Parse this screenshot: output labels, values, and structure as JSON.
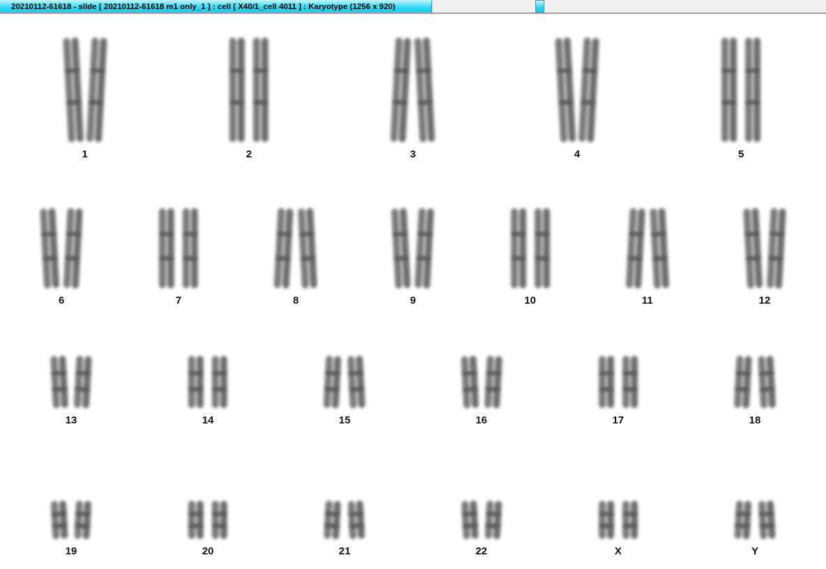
{
  "window": {
    "title": "20210112-61618 - slide [ 20210112-61618 m1 only_1 ] : cell [ X40/1_cell 4011 ] : Karyotype  (1256 x 920)"
  },
  "karyotype": {
    "rows": [
      {
        "items": [
          {
            "label": "1"
          },
          {
            "label": "2"
          },
          {
            "label": "3"
          },
          {
            "label": "4"
          },
          {
            "label": "5"
          }
        ]
      },
      {
        "items": [
          {
            "label": "6"
          },
          {
            "label": "7"
          },
          {
            "label": "8"
          },
          {
            "label": "9"
          },
          {
            "label": "10"
          },
          {
            "label": "11"
          },
          {
            "label": "12"
          }
        ]
      },
      {
        "items": [
          {
            "label": "13"
          },
          {
            "label": "14"
          },
          {
            "label": "15"
          },
          {
            "label": "16"
          },
          {
            "label": "17"
          },
          {
            "label": "18"
          }
        ]
      },
      {
        "items": [
          {
            "label": "19"
          },
          {
            "label": "20"
          },
          {
            "label": "21"
          },
          {
            "label": "22"
          },
          {
            "label": "X"
          },
          {
            "label": "Y"
          }
        ]
      }
    ]
  }
}
